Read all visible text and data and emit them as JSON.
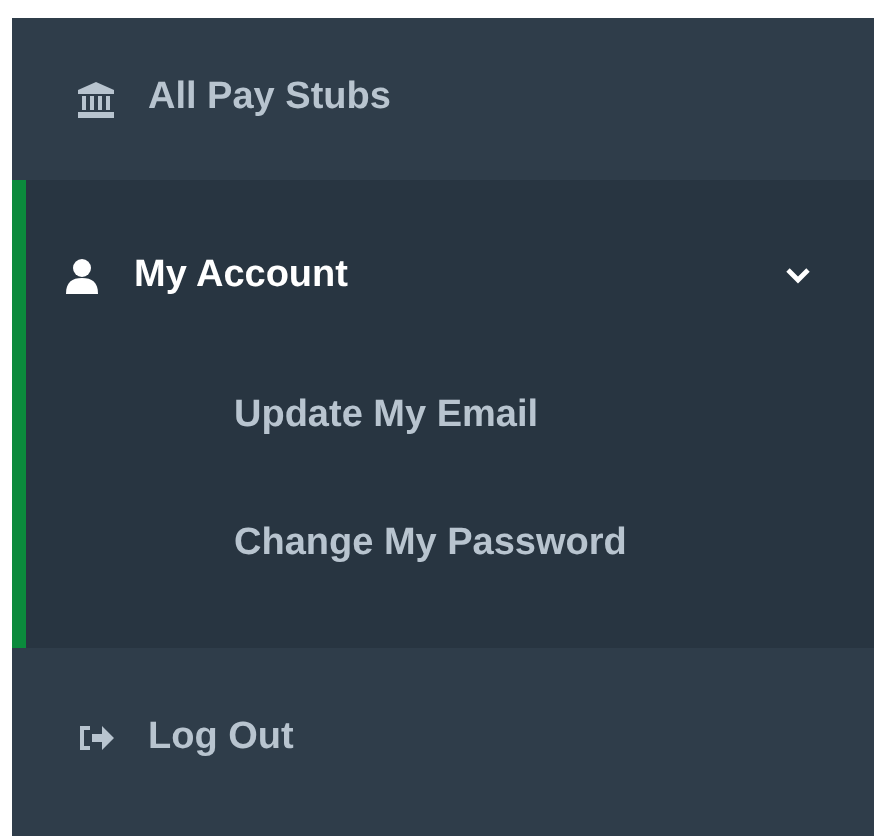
{
  "sidebar": {
    "items": [
      {
        "label": "All Pay Stubs",
        "selected": false
      },
      {
        "label": "My Account",
        "selected": true,
        "expanded": true,
        "children": [
          {
            "label": "Update My Email"
          },
          {
            "label": "Change My Password"
          }
        ]
      },
      {
        "label": "Log Out",
        "selected": false
      }
    ]
  }
}
